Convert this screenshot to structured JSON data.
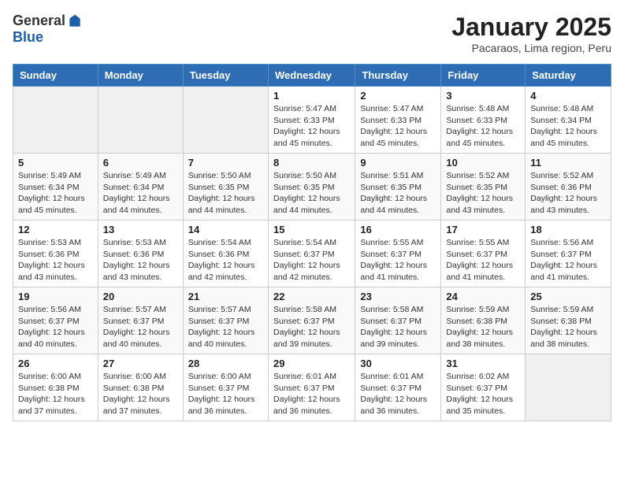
{
  "header": {
    "logo": {
      "general": "General",
      "blue": "Blue"
    },
    "title": "January 2025",
    "location": "Pacaraos, Lima region, Peru"
  },
  "days_of_week": [
    "Sunday",
    "Monday",
    "Tuesday",
    "Wednesday",
    "Thursday",
    "Friday",
    "Saturday"
  ],
  "weeks": [
    [
      {
        "day": "",
        "info": ""
      },
      {
        "day": "",
        "info": ""
      },
      {
        "day": "",
        "info": ""
      },
      {
        "day": "1",
        "info": "Sunrise: 5:47 AM\nSunset: 6:33 PM\nDaylight: 12 hours\nand 45 minutes."
      },
      {
        "day": "2",
        "info": "Sunrise: 5:47 AM\nSunset: 6:33 PM\nDaylight: 12 hours\nand 45 minutes."
      },
      {
        "day": "3",
        "info": "Sunrise: 5:48 AM\nSunset: 6:33 PM\nDaylight: 12 hours\nand 45 minutes."
      },
      {
        "day": "4",
        "info": "Sunrise: 5:48 AM\nSunset: 6:34 PM\nDaylight: 12 hours\nand 45 minutes."
      }
    ],
    [
      {
        "day": "5",
        "info": "Sunrise: 5:49 AM\nSunset: 6:34 PM\nDaylight: 12 hours\nand 45 minutes."
      },
      {
        "day": "6",
        "info": "Sunrise: 5:49 AM\nSunset: 6:34 PM\nDaylight: 12 hours\nand 44 minutes."
      },
      {
        "day": "7",
        "info": "Sunrise: 5:50 AM\nSunset: 6:35 PM\nDaylight: 12 hours\nand 44 minutes."
      },
      {
        "day": "8",
        "info": "Sunrise: 5:50 AM\nSunset: 6:35 PM\nDaylight: 12 hours\nand 44 minutes."
      },
      {
        "day": "9",
        "info": "Sunrise: 5:51 AM\nSunset: 6:35 PM\nDaylight: 12 hours\nand 44 minutes."
      },
      {
        "day": "10",
        "info": "Sunrise: 5:52 AM\nSunset: 6:35 PM\nDaylight: 12 hours\nand 43 minutes."
      },
      {
        "day": "11",
        "info": "Sunrise: 5:52 AM\nSunset: 6:36 PM\nDaylight: 12 hours\nand 43 minutes."
      }
    ],
    [
      {
        "day": "12",
        "info": "Sunrise: 5:53 AM\nSunset: 6:36 PM\nDaylight: 12 hours\nand 43 minutes."
      },
      {
        "day": "13",
        "info": "Sunrise: 5:53 AM\nSunset: 6:36 PM\nDaylight: 12 hours\nand 43 minutes."
      },
      {
        "day": "14",
        "info": "Sunrise: 5:54 AM\nSunset: 6:36 PM\nDaylight: 12 hours\nand 42 minutes."
      },
      {
        "day": "15",
        "info": "Sunrise: 5:54 AM\nSunset: 6:37 PM\nDaylight: 12 hours\nand 42 minutes."
      },
      {
        "day": "16",
        "info": "Sunrise: 5:55 AM\nSunset: 6:37 PM\nDaylight: 12 hours\nand 41 minutes."
      },
      {
        "day": "17",
        "info": "Sunrise: 5:55 AM\nSunset: 6:37 PM\nDaylight: 12 hours\nand 41 minutes."
      },
      {
        "day": "18",
        "info": "Sunrise: 5:56 AM\nSunset: 6:37 PM\nDaylight: 12 hours\nand 41 minutes."
      }
    ],
    [
      {
        "day": "19",
        "info": "Sunrise: 5:56 AM\nSunset: 6:37 PM\nDaylight: 12 hours\nand 40 minutes."
      },
      {
        "day": "20",
        "info": "Sunrise: 5:57 AM\nSunset: 6:37 PM\nDaylight: 12 hours\nand 40 minutes."
      },
      {
        "day": "21",
        "info": "Sunrise: 5:57 AM\nSunset: 6:37 PM\nDaylight: 12 hours\nand 40 minutes."
      },
      {
        "day": "22",
        "info": "Sunrise: 5:58 AM\nSunset: 6:37 PM\nDaylight: 12 hours\nand 39 minutes."
      },
      {
        "day": "23",
        "info": "Sunrise: 5:58 AM\nSunset: 6:37 PM\nDaylight: 12 hours\nand 39 minutes."
      },
      {
        "day": "24",
        "info": "Sunrise: 5:59 AM\nSunset: 6:38 PM\nDaylight: 12 hours\nand 38 minutes."
      },
      {
        "day": "25",
        "info": "Sunrise: 5:59 AM\nSunset: 6:38 PM\nDaylight: 12 hours\nand 38 minutes."
      }
    ],
    [
      {
        "day": "26",
        "info": "Sunrise: 6:00 AM\nSunset: 6:38 PM\nDaylight: 12 hours\nand 37 minutes."
      },
      {
        "day": "27",
        "info": "Sunrise: 6:00 AM\nSunset: 6:38 PM\nDaylight: 12 hours\nand 37 minutes."
      },
      {
        "day": "28",
        "info": "Sunrise: 6:00 AM\nSunset: 6:37 PM\nDaylight: 12 hours\nand 36 minutes."
      },
      {
        "day": "29",
        "info": "Sunrise: 6:01 AM\nSunset: 6:37 PM\nDaylight: 12 hours\nand 36 minutes."
      },
      {
        "day": "30",
        "info": "Sunrise: 6:01 AM\nSunset: 6:37 PM\nDaylight: 12 hours\nand 36 minutes."
      },
      {
        "day": "31",
        "info": "Sunrise: 6:02 AM\nSunset: 6:37 PM\nDaylight: 12 hours\nand 35 minutes."
      },
      {
        "day": "",
        "info": ""
      }
    ]
  ]
}
